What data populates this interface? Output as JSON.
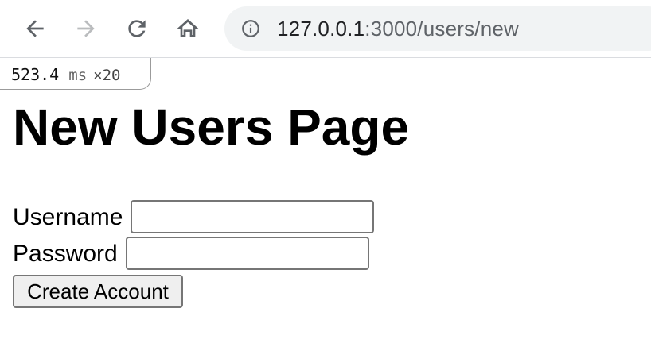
{
  "browser": {
    "url_host": "127.0.0.1",
    "url_rest": ":3000/users/new",
    "icons": [
      "back-arrow-icon",
      "forward-arrow-icon",
      "reload-icon",
      "home-icon",
      "info-icon"
    ]
  },
  "perf_badge": {
    "value": "523.4",
    "unit": "ms",
    "count": "×20"
  },
  "page": {
    "title": "New Users Page"
  },
  "form": {
    "username_label": "Username",
    "username_value": "",
    "password_label": "Password",
    "password_value": "",
    "submit_label": "Create Account"
  }
}
